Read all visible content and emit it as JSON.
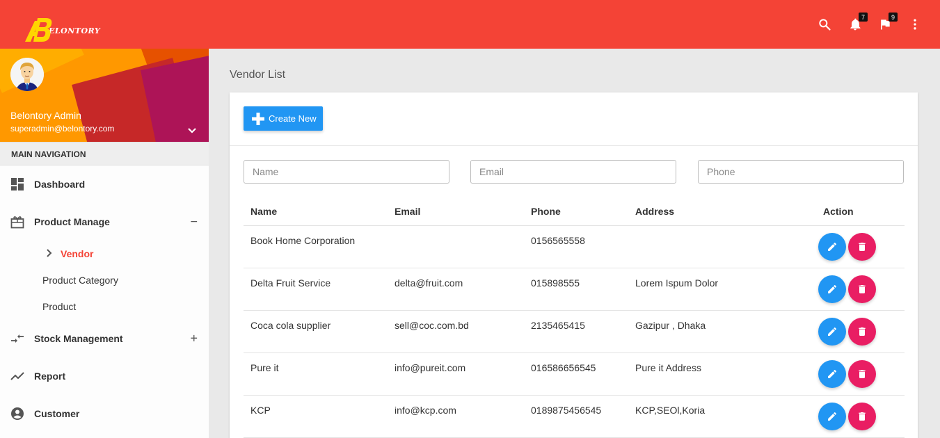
{
  "header": {
    "brand": "ELONTORY",
    "notifications_count": "7",
    "flags_count": "9",
    "icons": [
      "search-icon",
      "bell-icon",
      "flag-icon",
      "more-vert-icon"
    ],
    "color": "#f44336"
  },
  "user": {
    "name": "Belontory Admin",
    "email": "superadmin@belontory.com"
  },
  "nav": {
    "header": "MAIN NAVIGATION",
    "dashboard": "Dashboard",
    "product_manage": "Product Manage",
    "product_manage_toggle": "−",
    "vendor": "Vendor",
    "product_category": "Product Category",
    "product": "Product",
    "stock_management": "Stock Management",
    "stock_toggle": "+",
    "report": "Report",
    "customer": "Customer"
  },
  "page": {
    "title": "Vendor List",
    "create_label": "Create New"
  },
  "filters": {
    "name_placeholder": "Name",
    "email_placeholder": "Email",
    "phone_placeholder": "Phone"
  },
  "table": {
    "columns": [
      "Name",
      "Email",
      "Phone",
      "Address",
      "Action"
    ],
    "rows": [
      {
        "name": "Book Home Corporation",
        "email": "",
        "phone": "0156565558",
        "address": ""
      },
      {
        "name": "Delta Fruit Service",
        "email": "delta@fruit.com",
        "phone": "015898555",
        "address": "Lorem Ispum Dolor"
      },
      {
        "name": "Coca cola supplier",
        "email": "sell@coc.com.bd",
        "phone": "2135465415",
        "address": "Gazipur , Dhaka"
      },
      {
        "name": "Pure it",
        "email": "info@pureit.com",
        "phone": "016586656545",
        "address": "Pure it Address"
      },
      {
        "name": "KCP",
        "email": "info@kcp.com",
        "phone": "0189875456545",
        "address": "KCP,SEOl,Koria"
      }
    ]
  },
  "colors": {
    "edit": "#2196f3",
    "delete": "#e91e63",
    "active_nav": "#f44336"
  }
}
